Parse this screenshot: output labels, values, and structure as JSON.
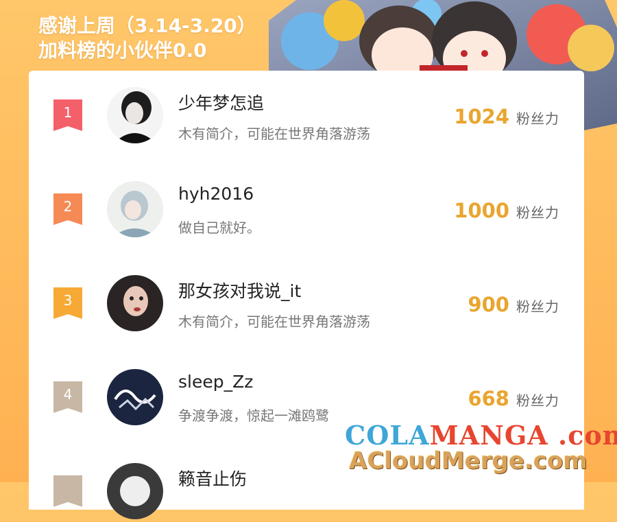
{
  "header": {
    "line1": "感谢上周（3.14-3.20）",
    "line2": "加料榜的小伙伴0.0"
  },
  "colors": {
    "background": "#ffbf62",
    "score": "#e9a52f",
    "rank1": "#f4606a",
    "rank2": "#f68a55",
    "rank3": "#f7a935",
    "rank4": "#c8b7a4"
  },
  "score_unit": "粉丝力",
  "list": [
    {
      "rank": "1",
      "name": "少年梦怎追",
      "bio": "木有简介，可能在世界角落游荡",
      "score": "1024"
    },
    {
      "rank": "2",
      "name": "hyh2016",
      "bio": "做自己就好。",
      "score": "1000"
    },
    {
      "rank": "3",
      "name": "那女孩对我说_it",
      "bio": "木有简介，可能在世界角落游荡",
      "score": "900"
    },
    {
      "rank": "4",
      "name": "sleep_Zz",
      "bio": "争渡争渡，惊起一滩鸥鹭",
      "score": "668"
    },
    {
      "rank": "",
      "name": "籁音止伤",
      "bio": "",
      "score": ""
    }
  ],
  "watermark": {
    "part1": "COLA",
    "part2": "MANGA",
    "part3": ".com",
    "line2": "ACloudMerge.com"
  }
}
